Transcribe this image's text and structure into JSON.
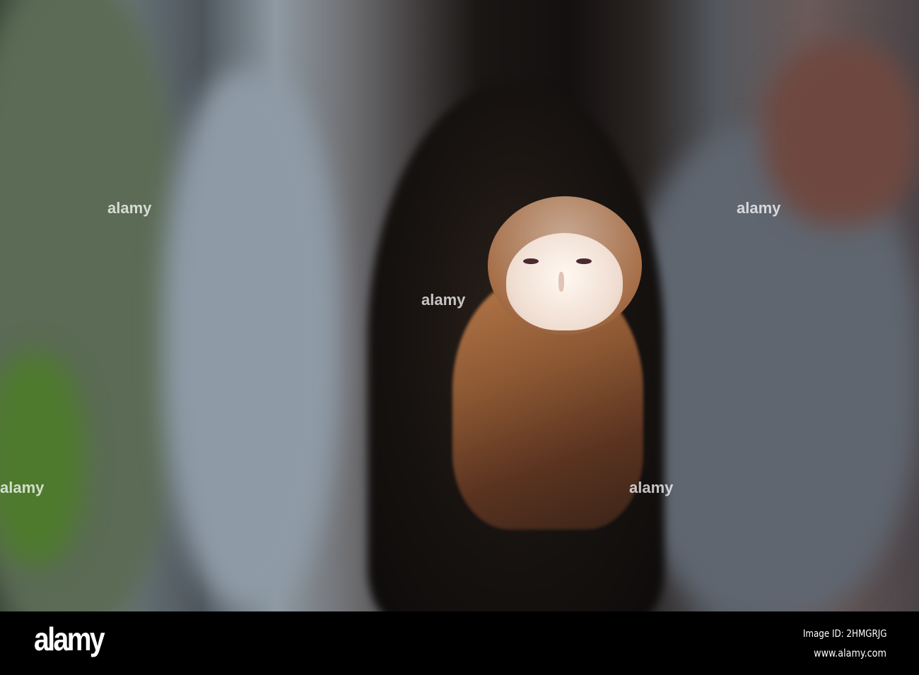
{
  "photo": {
    "subject": "barn-owl-in-tree-hollow",
    "watermark": "alamy"
  },
  "footer": {
    "logo": "alamy",
    "image_id": "Image ID: 2HMGRJG",
    "website": "www.alamy.com"
  }
}
